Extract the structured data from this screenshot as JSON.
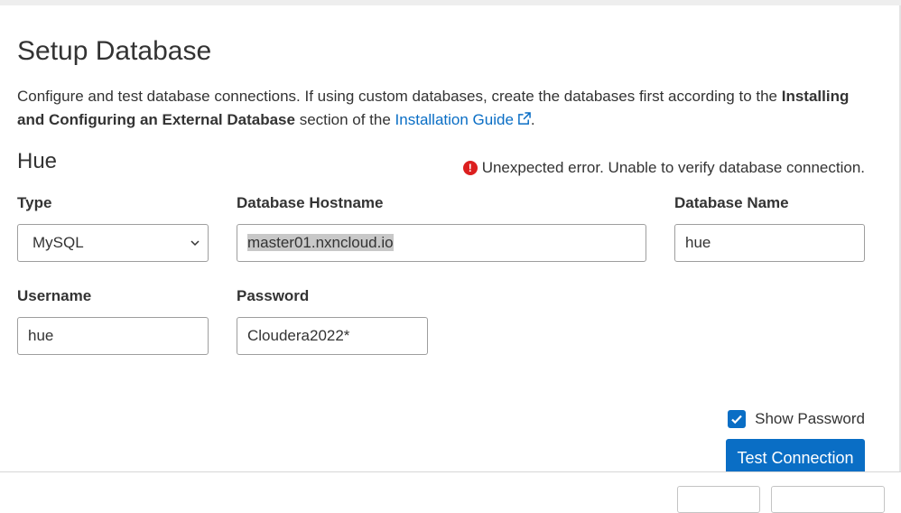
{
  "page": {
    "title": "Setup Database",
    "intro_text": "Configure and test database connections. If using custom databases, create the databases first according to the",
    "intro_bold": "Installing and Configuring an External Database",
    "intro_mid": "section of the",
    "guide_link": "Installation Guide",
    "intro_end": "."
  },
  "section": {
    "title": "Hue",
    "error": "Unexpected error. Unable to verify database connection."
  },
  "fields": {
    "type_label": "Type",
    "type_value": "MySQL",
    "hostname_label": "Database Hostname",
    "hostname_value": "master01.nxncloud.io",
    "dbname_label": "Database Name",
    "dbname_value": "hue",
    "username_label": "Username",
    "username_value": "hue",
    "password_label": "Password",
    "password_value": "Cloudera2022*"
  },
  "actions": {
    "show_password_label": "Show Password",
    "show_password_checked": true,
    "test_connection_label": "Test Connection"
  },
  "colors": {
    "accent": "#0a6ec5",
    "error": "#dc1f1f"
  },
  "icons": {
    "external": "external-link-icon",
    "error": "error-circle-icon",
    "dropdown": "chevron-down-icon",
    "check": "checkmark-icon"
  }
}
